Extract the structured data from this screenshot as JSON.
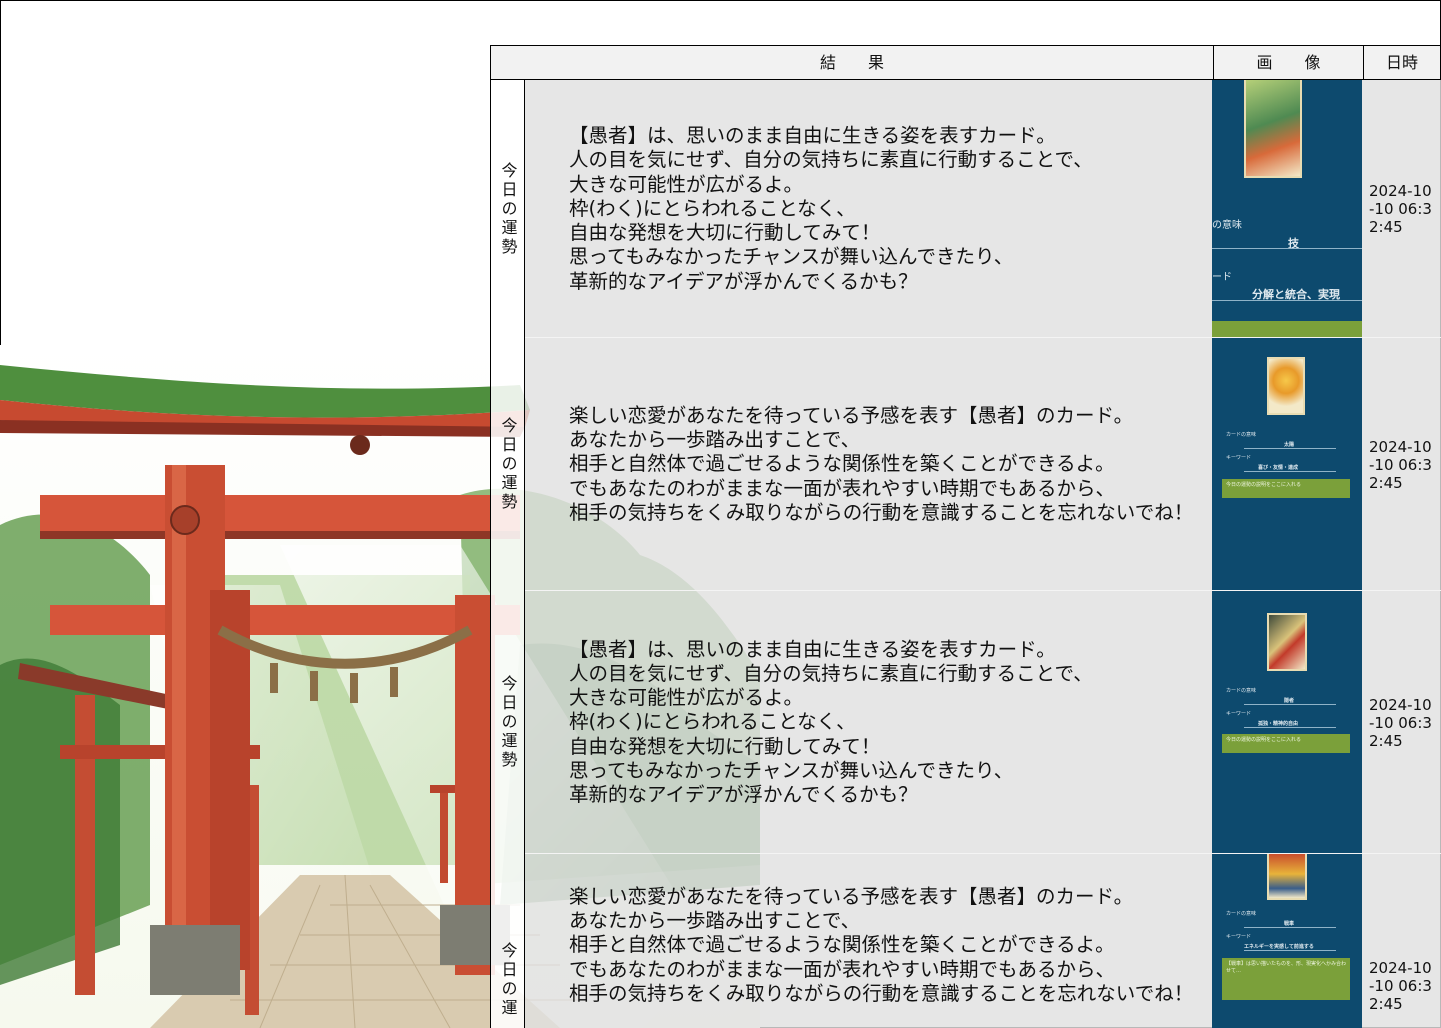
{
  "table": {
    "headers": {
      "result": "結　　果",
      "image": "画　　像",
      "date": "日時"
    },
    "rows": [
      {
        "label": "今日の運勢",
        "text": "【愚者】は、思いのまま自由に生きる姿を表すカード。\n人の目を気にせず、自分の気持ちに素直に行動することで、\n大きな可能性が広がるよ。\n枠(わく)にとらわれることなく、\n自由な発想を大切に行動してみて！\n思ってもみなかったチャンスが舞い込んできたり、\n革新的なアイデアが浮かんでくるかも？",
        "date": "2024-10-10 06:32:45",
        "image": {
          "meaning_label": "の意味",
          "meaning": "技",
          "keyword_label": "ード",
          "keyword": "分解と統合、実現"
        }
      },
      {
        "label": "今日の運勢",
        "text": "楽しい恋愛があなたを待っている予感を表す【愚者】のカード。\nあなたから一歩踏み出すことで、\n相手と自然体で過ごせるような関係性を築くことができるよ。\nでもあなたのわがままな一面が表れやすい時期でもあるから、\n相手の気持ちをくみ取りながらの行動を意識することを忘れないでね！",
        "date": "2024-10-10 06:32:45",
        "image": {
          "meaning_label": "カードの意味",
          "meaning": "太陽",
          "keyword_label": "キーワード",
          "keyword": "喜び・友情・達成",
          "note": "今日の運勢の説明をここに入れる"
        }
      },
      {
        "label": "今日の運勢",
        "text": "【愚者】は、思いのまま自由に生きる姿を表すカード。\n人の目を気にせず、自分の気持ちに素直に行動することで、\n大きな可能性が広がるよ。\n枠(わく)にとらわれることなく、\n自由な発想を大切に行動してみて！\n思ってもみなかったチャンスが舞い込んできたり、\n革新的なアイデアが浮かんでくるかも？",
        "date": "2024-10-10 06:32:45",
        "image": {
          "meaning_label": "カードの意味",
          "meaning": "隠者",
          "keyword_label": "キーワード",
          "keyword": "孤独・精神的自由",
          "note": "今日の運勢の説明をここに入れる"
        }
      },
      {
        "label": "今日の運",
        "text": "楽しい恋愛があなたを待っている予感を表す【愚者】のカード。\nあなたから一歩踏み出すことで、\n相手と自然体で過ごせるような関係性を築くことができるよ。\nでもあなたのわがままな一面が表れやすい時期でもあるから、\n相手の気持ちをくみ取りながらの行動を意識することを忘れないでね！",
        "date": "2024-10-10 06:32:45",
        "image": {
          "meaning_label": "カードの意味",
          "meaning": "戦車",
          "keyword_label": "キーワード",
          "keyword": "エネルギーを実感して前進する",
          "note": "【戦車】は思い描いたものを、形、現実化へかみ合わせて…"
        }
      }
    ]
  },
  "colors": {
    "card_panel": "#0d4a6e",
    "panel_green": "#7ba03a",
    "cell_gray": "#e0e0e0"
  }
}
